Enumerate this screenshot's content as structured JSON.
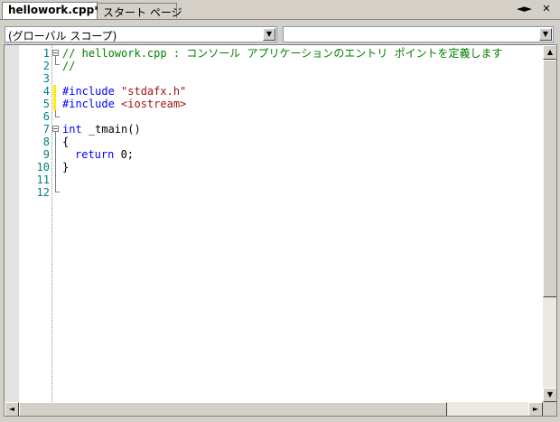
{
  "tabs": [
    {
      "label": "hellowork.cpp*",
      "active": true
    },
    {
      "label": "スタート ページ",
      "active": false
    }
  ],
  "tab_controls": {
    "scroll_icon": "◄►",
    "close_icon": "✕"
  },
  "scope_combo": {
    "value": "(グローバル スコープ)"
  },
  "member_combo": {
    "value": ""
  },
  "line_numbers": [
    "1",
    "2",
    "3",
    "4",
    "5",
    "6",
    "7",
    "8",
    "9",
    "10",
    "11",
    "12"
  ],
  "code": {
    "l1": "// hellowork.cpp : コンソール アプリケーションのエントリ ポイントを定義します",
    "l2": "//",
    "l4_kw": "#include",
    "l4_str": "\"stdafx.h\"",
    "l5_kw": "#include",
    "l5_str": "<iostream>",
    "l7_kw": "int",
    "l7_rest": " _tmain()",
    "l8": "{",
    "l9_kw": "return",
    "l9_rest": " 0;",
    "l10": "}"
  },
  "colors": {
    "keyword": "#0000ff",
    "comment": "#008000",
    "string": "#a31515",
    "line_number": "#008080"
  }
}
